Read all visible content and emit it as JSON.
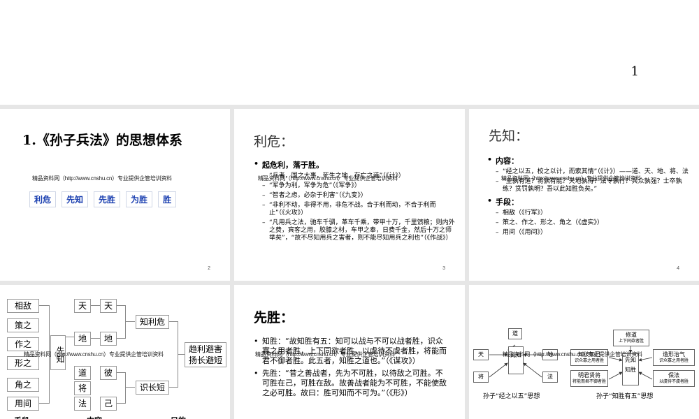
{
  "slide1": {
    "page_number": "1"
  },
  "watermark": "精品资料网（http://www.cnshu.cn）专业提供企管培训资料",
  "slide2": {
    "title": "1.《孙子兵法》的思想体系",
    "chain": [
      "利危",
      "先知",
      "先胜",
      "为胜",
      "胜"
    ],
    "page_number": "2"
  },
  "slide3": {
    "heading": "利危：",
    "bullet": "起危利，落于胜。",
    "items": [
      "“兵者，国之大事，死生之地，存亡之道”（《计》）",
      "“军争为利，军争为危”（《军争》）",
      "“智者之虑，必杂于利害”（《九变》）",
      "“非利不动，非得不用，非危不战。合于利而动，不合于利而止”（《火攻》）",
      "“凡用兵之法，驰车千驷，革车千乘，带甲十万，千里馈粮；则内外之费，宾客之用，胶膝之材，车甲之奉，日费千金，然后十万之师举矣”，“故不尽知用兵之害者，则不能尽知用兵之利也”（《作战》）"
    ],
    "page_number": "3"
  },
  "slide4": {
    "heading": "先知：",
    "content_label": "内容：",
    "content_items": [
      "“经之以五，校之以计，而索其情”（《计》）——道、天、地、将、法",
      "“主孰有道？将孰有能？天地孰得？法令孰行？兵众孰强？士卒孰练？赏罚孰明？吾以此知胜负矣。”"
    ],
    "means_label": "手段：",
    "means_items": [
      "相敌（《行军》）",
      "策之、作之、形之、角之（《虚实》）",
      "用间（《用间》）"
    ],
    "page_number": "4"
  },
  "slide5": {
    "means": [
      "相敌",
      "策之",
      "作之",
      "形之",
      "角之",
      "用间"
    ],
    "center": "先知",
    "col_a": [
      "天",
      "地",
      "道",
      "将",
      "法"
    ],
    "col_b": [
      "天",
      "地",
      "彼",
      "己"
    ],
    "result_a": "知利危",
    "result_b": "识长短",
    "goal_line1": "趋利避害",
    "goal_line2": "扬长避短",
    "footer": [
      "手段",
      "内容",
      "目的"
    ]
  },
  "slide6": {
    "heading": "先胜：",
    "bullets": [
      "知胜：“故知胜有五：知可以战与不可以战者胜，识众寡之用者胜，上下同欲者胜，以虞待不虞者胜，将能而君不御者胜。此五者，知胜之道也。”（《谋攻》）",
      "先胜：“昔之善战者，先为不可胜，以待敌之可胜。不可胜在己，可胜在敌。故善战者能为不可胜，不能使敌之必可胜。故曰：胜可知而不可为。”（《形》）"
    ]
  },
  "slide7": {
    "left": {
      "top": "道",
      "left": "天",
      "center": "先知",
      "right": "地",
      "bottom_left": "将",
      "bottom_right": "法",
      "caption": "孙子“经之以五”思想"
    },
    "right": {
      "top_title": "修道",
      "top_sub": "上下同欲者胜",
      "center": "先知",
      "center2": "知胜",
      "left_a": "知彼知己",
      "left_a_sub": "识众寡之用者胜",
      "left_b": "明君贤将",
      "left_b_sub": "将能而君不御者胜",
      "right_a": "造形治气",
      "right_a_sub": "识众寡之用者胜",
      "right_b": "保法",
      "right_b_sub": "以虞待不虞者胜",
      "caption": "孙子“知胜有五”思想"
    }
  }
}
